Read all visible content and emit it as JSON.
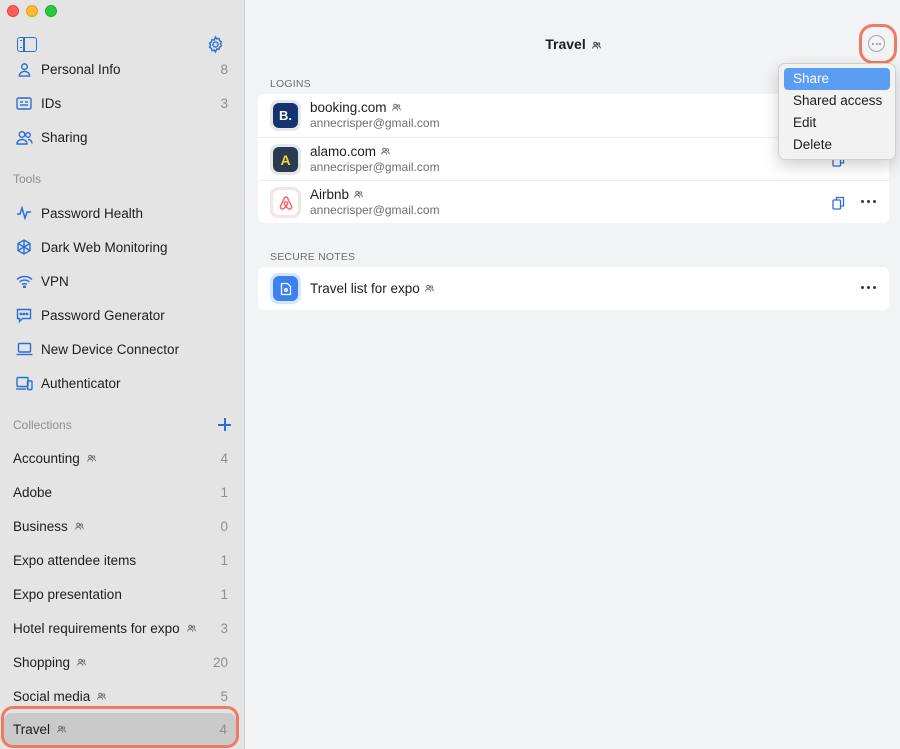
{
  "window": {
    "title": "Travel"
  },
  "sidebar": {
    "top_items": [
      {
        "label": "Personal Info",
        "count": "8",
        "icon": "person-icon"
      },
      {
        "label": "IDs",
        "count": "3",
        "icon": "id-card-icon"
      },
      {
        "label": "Sharing",
        "count": "",
        "icon": "sharing-icon"
      }
    ],
    "tools_header": "Tools",
    "tools": [
      {
        "label": "Password Health",
        "icon": "pulse-icon"
      },
      {
        "label": "Dark Web Monitoring",
        "icon": "dark-web-icon"
      },
      {
        "label": "VPN",
        "icon": "vpn-icon"
      },
      {
        "label": "Password Generator",
        "icon": "password-generator-icon"
      },
      {
        "label": "New Device Connector",
        "icon": "laptop-icon"
      },
      {
        "label": "Authenticator",
        "icon": "authenticator-icon"
      }
    ],
    "collections_header": "Collections",
    "collections": [
      {
        "label": "Accounting",
        "count": "4",
        "shared": true
      },
      {
        "label": "Adobe",
        "count": "1",
        "shared": false
      },
      {
        "label": "Business",
        "count": "0",
        "shared": true
      },
      {
        "label": "Expo attendee items",
        "count": "1",
        "shared": false
      },
      {
        "label": "Expo presentation",
        "count": "1",
        "shared": false
      },
      {
        "label": "Hotel requirements for expo",
        "count": "3",
        "shared": true
      },
      {
        "label": "Shopping",
        "count": "20",
        "shared": true
      },
      {
        "label": "Social media",
        "count": "5",
        "shared": true
      },
      {
        "label": "Travel",
        "count": "4",
        "shared": true,
        "selected": true
      }
    ]
  },
  "main": {
    "title": "Travel",
    "logins_header": "LOGINS",
    "logins": [
      {
        "name": "booking.com",
        "user": "annecrisper@gmail.com",
        "logo": "B."
      },
      {
        "name": "alamo.com",
        "user": "annecrisper@gmail.com",
        "logo": "A"
      },
      {
        "name": "Airbnb",
        "user": "annecrisper@gmail.com",
        "logo": "airbnb"
      }
    ],
    "notes_header": "SECURE NOTES",
    "notes": [
      {
        "name": "Travel list for expo"
      }
    ]
  },
  "menu": {
    "items": [
      "Share",
      "Shared access",
      "Edit",
      "Delete"
    ],
    "active": "Share"
  },
  "colors": {
    "accent": "#2a6fd6",
    "highlight_ring": "#f07a61",
    "menu_active": "#5c9df4"
  }
}
